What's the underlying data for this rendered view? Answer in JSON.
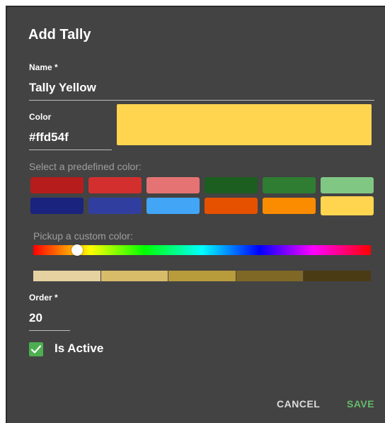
{
  "dialog": {
    "title": "Add Tally"
  },
  "name_field": {
    "label": "Name *",
    "value": "Tally Yellow"
  },
  "color_field": {
    "label": "Color",
    "value": "#ffd54f",
    "preview_color": "#ffd54f"
  },
  "predefined": {
    "label": "Select a predefined color:",
    "swatches": [
      {
        "color": "#b71c1c"
      },
      {
        "color": "#d32f2f"
      },
      {
        "color": "#e57373"
      },
      {
        "color": "#1b5e20"
      },
      {
        "color": "#2e7d32"
      },
      {
        "color": "#81c784"
      },
      {
        "color": "#1a237e"
      },
      {
        "color": "#303f9f"
      },
      {
        "color": "#42a5f5"
      },
      {
        "color": "#e65100"
      },
      {
        "color": "#fb8c00"
      },
      {
        "color": "#ffd54f"
      }
    ],
    "selected_index": 11
  },
  "custom": {
    "label": "Pickup a custom color:",
    "hue_position": 0.13,
    "shades": [
      "#e6d1a1",
      "#d8bc6a",
      "#b89b3b",
      "#7f6826",
      "#4a3b14"
    ]
  },
  "order_field": {
    "label": "Order *",
    "value": "20"
  },
  "is_active": {
    "label": "Is Active",
    "checked": true,
    "check_color": "#4caf50"
  },
  "actions": {
    "cancel_label": "CANCEL",
    "save_label": "SAVE",
    "save_color": "#66bb6a"
  }
}
